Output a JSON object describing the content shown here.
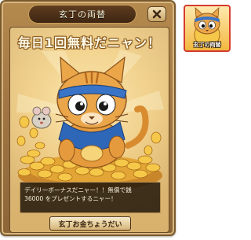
{
  "dialog": {
    "title": "玄丁の両替",
    "close_label": "X",
    "headline": "毎日1回無料だニャン！",
    "message_lines": [
      "デイリーボーナスだニャー！！無償で銭",
      "36000 をプレゼントするニャー！"
    ],
    "collect_button_label": "玄丁お金ちょうだい",
    "illustration_icon": "ninja-cat-with-coins"
  },
  "side_item": {
    "label": "玄丁の両替",
    "icon": "ninja-cat-coin-icon",
    "border_color": "#d63b2e"
  },
  "colors": {
    "panel": "#a27644",
    "title_bar": "#4a2c15",
    "gold": "#f2b83f"
  }
}
